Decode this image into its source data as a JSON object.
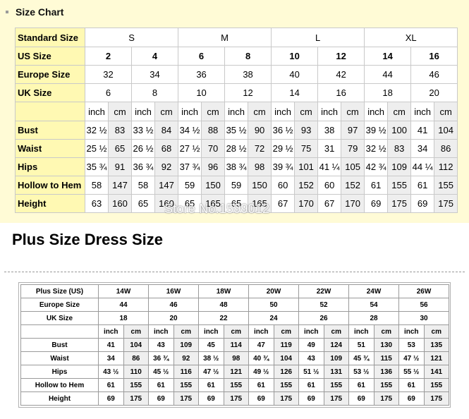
{
  "size_chart": {
    "title": "Size Chart",
    "standard_label": "Standard Size",
    "standard_sizes": [
      "S",
      "M",
      "L",
      "XL"
    ],
    "us_label": "US Size",
    "us_sizes": [
      "2",
      "4",
      "6",
      "8",
      "10",
      "12",
      "14",
      "16"
    ],
    "europe_label": "Europe Size",
    "europe_sizes": [
      "32",
      "34",
      "36",
      "38",
      "40",
      "42",
      "44",
      "46"
    ],
    "uk_label": "UK Size",
    "uk_sizes": [
      "6",
      "8",
      "10",
      "12",
      "14",
      "16",
      "18",
      "20"
    ],
    "unit_inch": "inch",
    "unit_cm": "cm",
    "rows": [
      {
        "label": "Bust",
        "values": [
          "32 ½",
          "83",
          "33 ½",
          "84",
          "34 ½",
          "88",
          "35 ½",
          "90",
          "36 ½",
          "93",
          "38",
          "97",
          "39 ½",
          "100",
          "41",
          "104"
        ]
      },
      {
        "label": "Waist",
        "values": [
          "25 ½",
          "65",
          "26 ½",
          "68",
          "27 ½",
          "70",
          "28 ½",
          "72",
          "29 ½",
          "75",
          "31",
          "79",
          "32 ½",
          "83",
          "34",
          "86"
        ]
      },
      {
        "label": "Hips",
        "values": [
          "35 ¾",
          "91",
          "36 ¾",
          "92",
          "37 ¾",
          "96",
          "38 ¾",
          "98",
          "39 ¾",
          "101",
          "41 ¼",
          "105",
          "42 ¾",
          "109",
          "44 ¼",
          "112"
        ]
      },
      {
        "label": "Hollow to Hem",
        "values": [
          "58",
          "147",
          "58",
          "147",
          "59",
          "150",
          "59",
          "150",
          "60",
          "152",
          "60",
          "152",
          "61",
          "155",
          "61",
          "155"
        ]
      },
      {
        "label": "Height",
        "values": [
          "63",
          "160",
          "65",
          "160",
          "65",
          "165",
          "65",
          "165",
          "67",
          "170",
          "67",
          "170",
          "69",
          "175",
          "69",
          "175"
        ]
      }
    ]
  },
  "watermark": "Store No.1599012",
  "plus_chart": {
    "title": "Plus Size Dress Size",
    "us_label": "Plus Size (US)",
    "us_sizes": [
      "14W",
      "16W",
      "18W",
      "20W",
      "22W",
      "24W",
      "26W"
    ],
    "europe_label": "Europe Size",
    "europe_sizes": [
      "44",
      "46",
      "48",
      "50",
      "52",
      "54",
      "56"
    ],
    "uk_label": "UK Size",
    "uk_sizes": [
      "18",
      "20",
      "22",
      "24",
      "26",
      "28",
      "30"
    ],
    "unit_inch": "inch",
    "unit_cm": "cm",
    "rows": [
      {
        "label": "Bust",
        "values": [
          "41",
          "104",
          "43",
          "109",
          "45",
          "114",
          "47",
          "119",
          "49",
          "124",
          "51",
          "130",
          "53",
          "135"
        ]
      },
      {
        "label": "Waist",
        "values": [
          "34",
          "86",
          "36 ¾",
          "92",
          "38 ½",
          "98",
          "40 ¾",
          "104",
          "43",
          "109",
          "45 ¾",
          "115",
          "47 ½",
          "121"
        ]
      },
      {
        "label": "Hips",
        "values": [
          "43 ½",
          "110",
          "45 ½",
          "116",
          "47 ½",
          "121",
          "49 ½",
          "126",
          "51 ½",
          "131",
          "53 ½",
          "136",
          "55 ½",
          "141"
        ]
      },
      {
        "label": "Hollow to Hem",
        "values": [
          "61",
          "155",
          "61",
          "155",
          "61",
          "155",
          "61",
          "155",
          "61",
          "155",
          "61",
          "155",
          "61",
          "155"
        ]
      },
      {
        "label": "Height",
        "values": [
          "69",
          "175",
          "69",
          "175",
          "69",
          "175",
          "69",
          "175",
          "69",
          "175",
          "69",
          "175",
          "69",
          "175"
        ]
      }
    ]
  }
}
